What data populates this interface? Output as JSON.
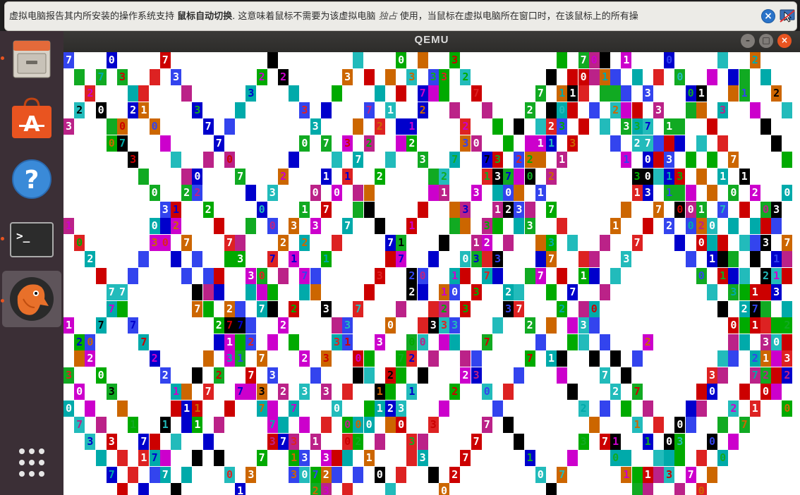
{
  "notification": {
    "text_prefix": "虚拟电脑报告其内所安装的操作系统支持 ",
    "text_bold": "鼠标自动切换",
    "text_mid": ". 这意味着鼠标不需要为该虚拟电脑 ",
    "text_italic": "独占",
    "text_suffix": " 使用，当鼠标在虚拟电脑所在窗口时，在该鼠标上的所有操",
    "close_icon": "close-circle-icon",
    "mouse_icon": "mouse-integration-icon"
  },
  "dock": {
    "items": [
      {
        "name": "files",
        "icon": "file-cabinet-icon",
        "running": true,
        "active": false
      },
      {
        "name": "software",
        "icon": "shopping-bag-icon",
        "running": false,
        "active": false
      },
      {
        "name": "help",
        "icon": "help-icon",
        "running": false,
        "active": false
      },
      {
        "name": "terminal",
        "icon": "terminal-icon",
        "running": true,
        "active": false
      },
      {
        "name": "qemu",
        "icon": "qemu-icon",
        "running": true,
        "active": true
      }
    ],
    "apps_icon": "app-grid-icon"
  },
  "window": {
    "title": "QEMU",
    "min_icon": "minimize-icon",
    "max_icon": "maximize-icon",
    "close_icon": "close-icon"
  },
  "screen": {
    "background": "#ffffff",
    "palette": [
      "#000000",
      "#cc0000",
      "#0000cc",
      "#cc00cc",
      "#00aa00",
      "#00aaaa",
      "#cc6600",
      "#aaaaaa"
    ],
    "glyphs": [
      "0",
      "1",
      "2",
      "3",
      "7"
    ]
  }
}
